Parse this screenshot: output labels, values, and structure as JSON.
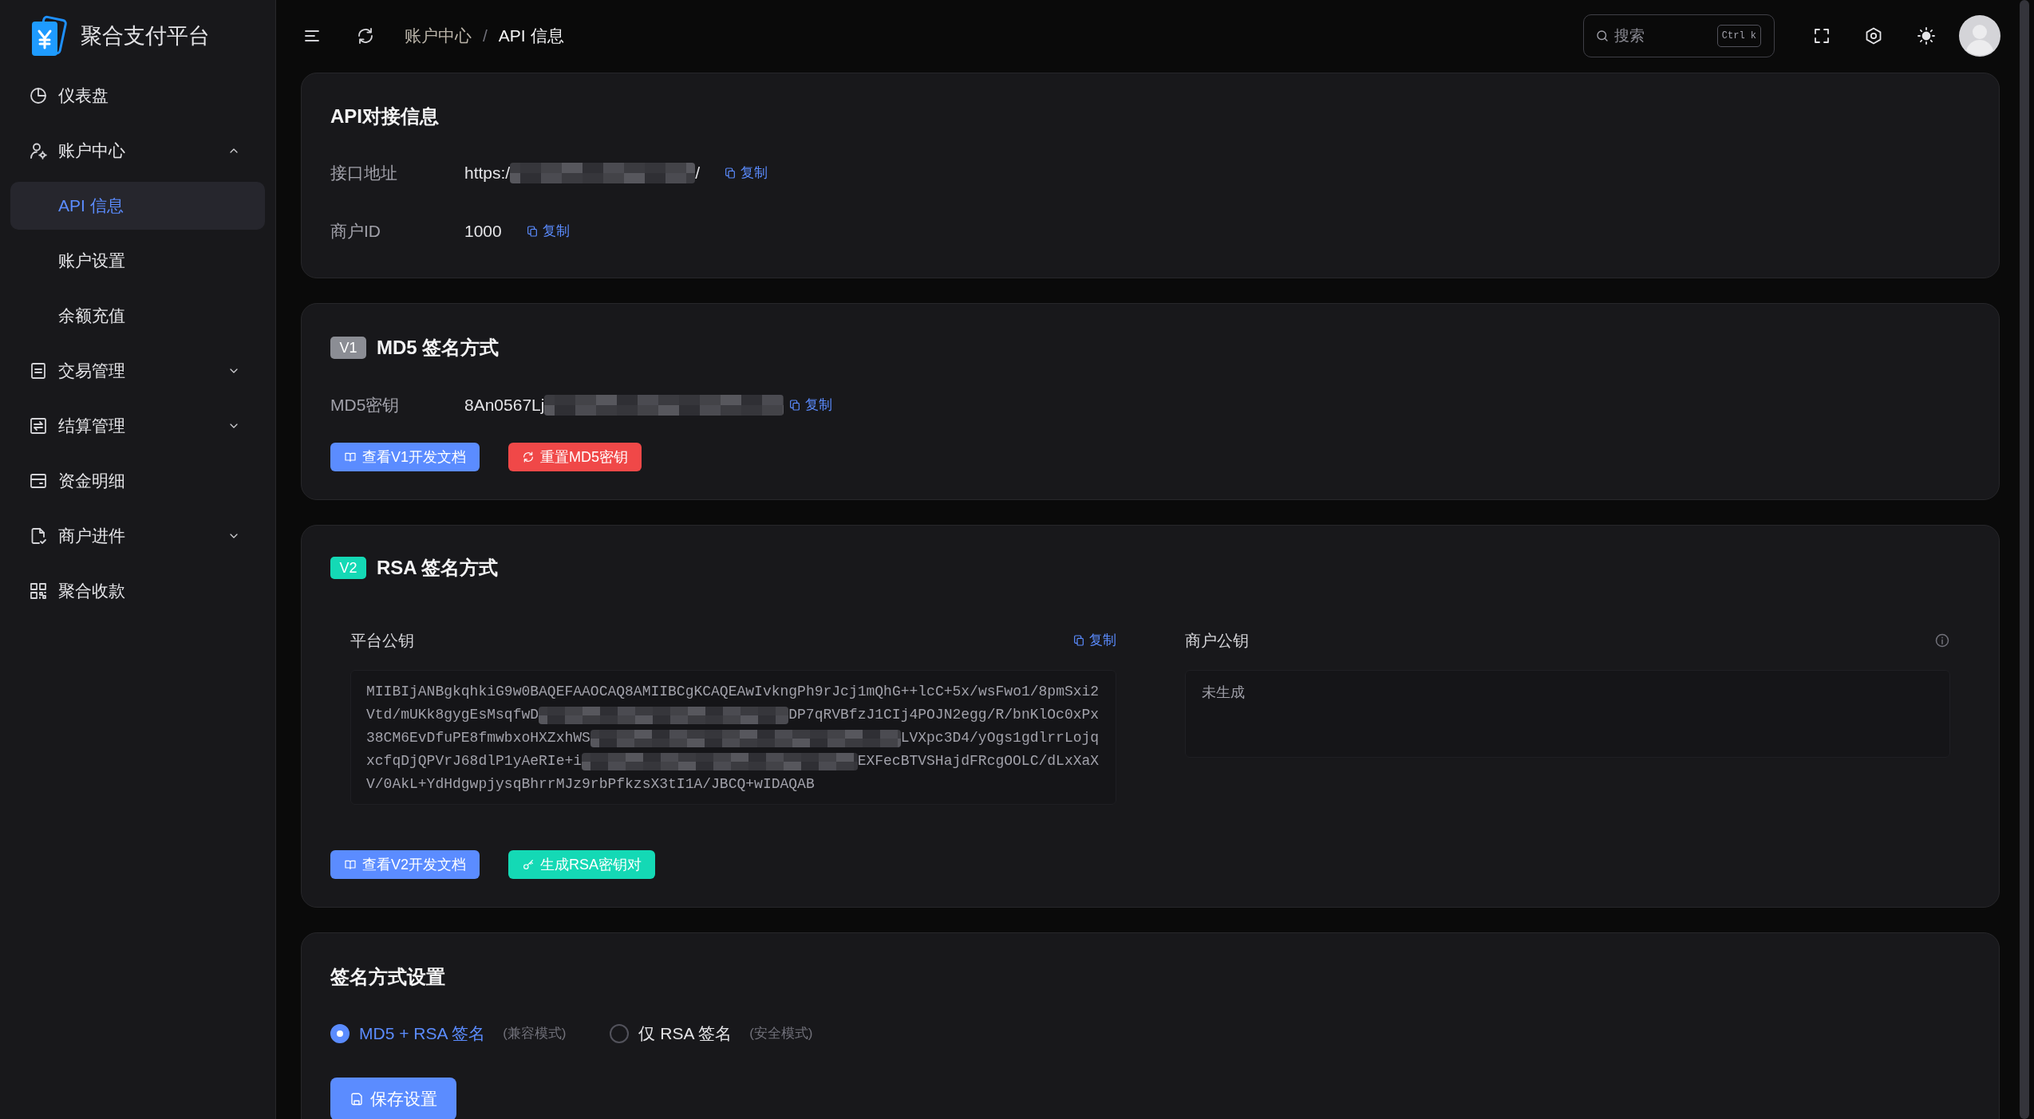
{
  "sidebar": {
    "logo": "聚合支付平台",
    "items": [
      {
        "label": "仪表盘",
        "selected": false
      },
      {
        "label": "账户中心",
        "selected": false,
        "expanded": true,
        "children": [
          {
            "label": "API 信息",
            "selected": true
          },
          {
            "label": "账户设置",
            "selected": false
          },
          {
            "label": "余额充值",
            "selected": false
          }
        ]
      },
      {
        "label": "交易管理",
        "selected": false,
        "expanded": false
      },
      {
        "label": "结算管理",
        "selected": false,
        "expanded": false
      },
      {
        "label": "资金明细",
        "selected": false
      },
      {
        "label": "商户进件",
        "selected": false,
        "expanded": false
      },
      {
        "label": "聚合收款",
        "selected": false
      }
    ]
  },
  "header": {
    "breadcrumb": [
      "账户中心",
      "API 信息"
    ],
    "separator": "/",
    "search": {
      "placeholder": "搜索",
      "shortcut": "Ctrl k"
    }
  },
  "api_info": {
    "title": "API对接信息",
    "fields": [
      {
        "label": "接口地址",
        "value": "https:/",
        "redacted": true,
        "value_end": "/",
        "copy": "复制"
      },
      {
        "label": "商户ID",
        "value": "1000",
        "redacted": false,
        "copy": "复制"
      }
    ]
  },
  "md5": {
    "badge": "V1",
    "title": "MD5 签名方式",
    "fields": [
      {
        "label": "MD5密钥",
        "value": "8An0567Lj",
        "redacted": true,
        "copy": "复制"
      }
    ],
    "buttons": [
      {
        "label": "查看V1开发文档",
        "kind": "docs"
      },
      {
        "label": "重置MD5密钥",
        "kind": "reset"
      }
    ]
  },
  "rsa": {
    "badge": "V2",
    "title": "RSA 签名方式",
    "platform_key": {
      "title": "平台公钥",
      "copy": "复制",
      "lines": [
        {
          "text": "MIIBIjANBgkqhkiG9w0BAQEFAAOCAQ8AMIIBCgKCAQEAwIvkngPh9rJcj1mQhG++lcC+5x/wsFwo1/8pmSxi2",
          "redacted": false
        },
        {
          "text": "Vtd/mUKk8gygEsMsqfwD",
          "redacted": true,
          "text_end": "DP7qRVBfzJ1CIj4POJN2egg/R/bnKlOc0xPx"
        },
        {
          "text": "38CM6EvDfuPE8fmwbxoHXZxhWS",
          "redacted": true,
          "text_end": "LVXpc3D4/yOgs1gdlrrLojq"
        },
        {
          "text": "xcfqDjQPVrJ68dlP1yAeRIe+i",
          "redacted": true,
          "text_end": "EXFecBTVSHajdFRcgOOLC/dLxXaX"
        },
        {
          "text": "V/0AkL+YdHdgwpjysqBhrrMJz9rbPfkzsX3tI1A/JBCQ+wIDAQAB",
          "redacted": false
        }
      ]
    },
    "merchant_key": {
      "title": "商户公钥",
      "value": "未生成"
    },
    "buttons": [
      {
        "label": "查看V2开发文档",
        "kind": "docs"
      },
      {
        "label": "生成RSA密钥对",
        "kind": "generate"
      }
    ]
  },
  "signature_settings": {
    "title": "签名方式设置",
    "options": [
      {
        "label": "MD5 + RSA 签名",
        "note": "(兼容模式)",
        "selected": true
      },
      {
        "label": "仅 RSA 签名",
        "note": "(安全模式)",
        "selected": false
      }
    ],
    "save_button": "保存设置"
  }
}
